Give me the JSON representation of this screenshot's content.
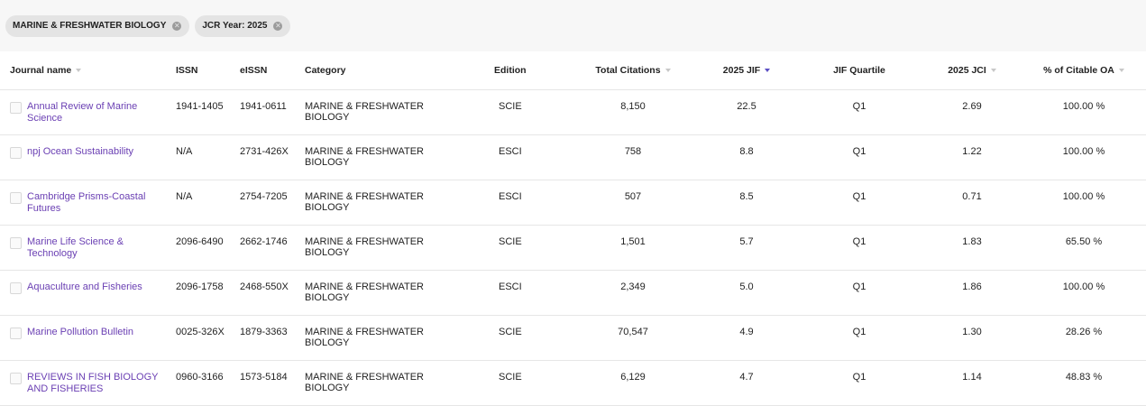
{
  "filters": [
    {
      "label": "MARINE & FRESHWATER BIOLOGY"
    },
    {
      "label": "JCR Year: 2025"
    }
  ],
  "columns": {
    "journal": "Journal name",
    "issn": "ISSN",
    "eissn": "eISSN",
    "category": "Category",
    "edition": "Edition",
    "total_citations": "Total Citations",
    "jif": "2025 JIF",
    "quartile": "JIF Quartile",
    "jci": "2025 JCI",
    "oa": "% of Citable OA"
  },
  "rows": [
    {
      "journal": "Annual Review of Marine Science",
      "issn": "1941-1405",
      "eissn": "1941-0611",
      "category": "MARINE & FRESHWATER BIOLOGY",
      "edition": "SCIE",
      "total_citations": "8,150",
      "jif": "22.5",
      "quartile": "Q1",
      "jci": "2.69",
      "oa": "100.00 %"
    },
    {
      "journal": "npj Ocean Sustainability",
      "issn": "N/A",
      "eissn": "2731-426X",
      "category": "MARINE & FRESHWATER BIOLOGY",
      "edition": "ESCI",
      "total_citations": "758",
      "jif": "8.8",
      "quartile": "Q1",
      "jci": "1.22",
      "oa": "100.00 %"
    },
    {
      "journal": "Cambridge Prisms-Coastal Futures",
      "issn": "N/A",
      "eissn": "2754-7205",
      "category": "MARINE & FRESHWATER BIOLOGY",
      "edition": "ESCI",
      "total_citations": "507",
      "jif": "8.5",
      "quartile": "Q1",
      "jci": "0.71",
      "oa": "100.00 %"
    },
    {
      "journal": "Marine Life Science & Technology",
      "issn": "2096-6490",
      "eissn": "2662-1746",
      "category": "MARINE & FRESHWATER BIOLOGY",
      "edition": "SCIE",
      "total_citations": "1,501",
      "jif": "5.7",
      "quartile": "Q1",
      "jci": "1.83",
      "oa": "65.50 %"
    },
    {
      "journal": "Aquaculture and Fisheries",
      "issn": "2096-1758",
      "eissn": "2468-550X",
      "category": "MARINE & FRESHWATER BIOLOGY",
      "edition": "ESCI",
      "total_citations": "2,349",
      "jif": "5.0",
      "quartile": "Q1",
      "jci": "1.86",
      "oa": "100.00 %"
    },
    {
      "journal": "Marine Pollution Bulletin",
      "issn": "0025-326X",
      "eissn": "1879-3363",
      "category": "MARINE & FRESHWATER BIOLOGY",
      "edition": "SCIE",
      "total_citations": "70,547",
      "jif": "4.9",
      "quartile": "Q1",
      "jci": "1.30",
      "oa": "28.26 %"
    },
    {
      "journal": "REVIEWS IN FISH BIOLOGY AND FISHERIES",
      "issn": "0960-3166",
      "eissn": "1573-5184",
      "category": "MARINE & FRESHWATER BIOLOGY",
      "edition": "SCIE",
      "total_citations": "6,129",
      "jif": "4.7",
      "quartile": "Q1",
      "jci": "1.14",
      "oa": "48.83 %"
    }
  ],
  "colors": {
    "link": "#6a3fb3",
    "sort_active": "#5b4fc4"
  }
}
